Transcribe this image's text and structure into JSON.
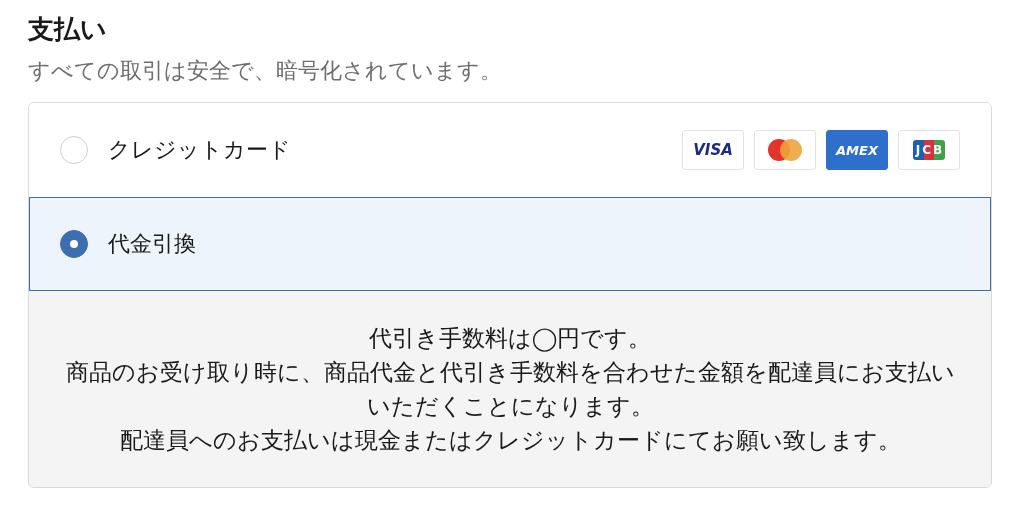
{
  "title": "支払い",
  "subtitle": "すべての取引は安全で、暗号化されています。",
  "options": [
    {
      "label": "クレジットカード",
      "selected": false,
      "cards": [
        {
          "kind": "visa",
          "label": "VISA"
        },
        {
          "kind": "mastercard"
        },
        {
          "kind": "amex",
          "label": "AMEX"
        },
        {
          "kind": "jcb",
          "label": "JCB"
        }
      ]
    },
    {
      "label": "代金引換",
      "selected": true,
      "details": [
        "代引き手数料は◯円です。",
        "商品のお受け取り時に、商品代金と代引き手数料を合わせた金額を配達員にお支払いいただくことになります。",
        "配達員へのお支払いは現金またはクレジットカードにてお願い致します。"
      ]
    }
  ]
}
